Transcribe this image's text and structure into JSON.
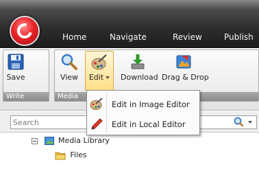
{
  "tabs": [
    "Home",
    "Navigate",
    "Review",
    "Publish"
  ],
  "ribbon": {
    "groups": {
      "write": "Write",
      "media": "Media"
    },
    "buttons": {
      "save": "Save",
      "view": "View",
      "edit": "Edit",
      "download": "Download",
      "drag_drop": "Drag & Drop"
    }
  },
  "edit_menu": {
    "items": [
      "Edit in Image Editor",
      "Edit in Local Editor"
    ]
  },
  "search": {
    "placeholder": "Search"
  },
  "tree": {
    "items": [
      "Media Library",
      "Files"
    ]
  },
  "colors": {
    "orb": "#e8242a",
    "edit_highlight": "#ffdf8a",
    "tab_text": "#f4f4f4"
  }
}
